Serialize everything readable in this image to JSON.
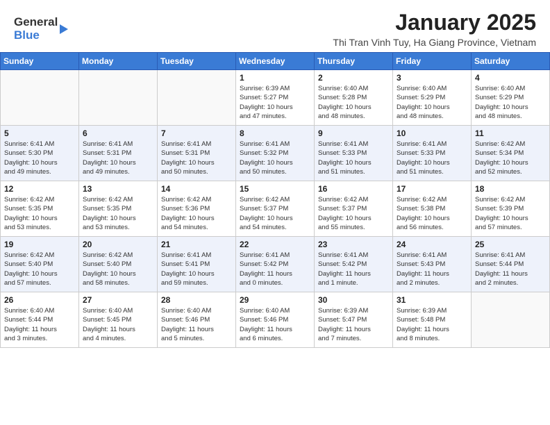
{
  "header": {
    "logo_general": "General",
    "logo_blue": "Blue",
    "month_year": "January 2025",
    "location": "Thi Tran Vinh Tuy, Ha Giang Province, Vietnam"
  },
  "days_of_week": [
    "Sunday",
    "Monday",
    "Tuesday",
    "Wednesday",
    "Thursday",
    "Friday",
    "Saturday"
  ],
  "weeks": [
    [
      {
        "day": "",
        "info": ""
      },
      {
        "day": "",
        "info": ""
      },
      {
        "day": "",
        "info": ""
      },
      {
        "day": "1",
        "info": "Sunrise: 6:39 AM\nSunset: 5:27 PM\nDaylight: 10 hours\nand 47 minutes."
      },
      {
        "day": "2",
        "info": "Sunrise: 6:40 AM\nSunset: 5:28 PM\nDaylight: 10 hours\nand 48 minutes."
      },
      {
        "day": "3",
        "info": "Sunrise: 6:40 AM\nSunset: 5:29 PM\nDaylight: 10 hours\nand 48 minutes."
      },
      {
        "day": "4",
        "info": "Sunrise: 6:40 AM\nSunset: 5:29 PM\nDaylight: 10 hours\nand 48 minutes."
      }
    ],
    [
      {
        "day": "5",
        "info": "Sunrise: 6:41 AM\nSunset: 5:30 PM\nDaylight: 10 hours\nand 49 minutes."
      },
      {
        "day": "6",
        "info": "Sunrise: 6:41 AM\nSunset: 5:31 PM\nDaylight: 10 hours\nand 49 minutes."
      },
      {
        "day": "7",
        "info": "Sunrise: 6:41 AM\nSunset: 5:31 PM\nDaylight: 10 hours\nand 50 minutes."
      },
      {
        "day": "8",
        "info": "Sunrise: 6:41 AM\nSunset: 5:32 PM\nDaylight: 10 hours\nand 50 minutes."
      },
      {
        "day": "9",
        "info": "Sunrise: 6:41 AM\nSunset: 5:33 PM\nDaylight: 10 hours\nand 51 minutes."
      },
      {
        "day": "10",
        "info": "Sunrise: 6:41 AM\nSunset: 5:33 PM\nDaylight: 10 hours\nand 51 minutes."
      },
      {
        "day": "11",
        "info": "Sunrise: 6:42 AM\nSunset: 5:34 PM\nDaylight: 10 hours\nand 52 minutes."
      }
    ],
    [
      {
        "day": "12",
        "info": "Sunrise: 6:42 AM\nSunset: 5:35 PM\nDaylight: 10 hours\nand 53 minutes."
      },
      {
        "day": "13",
        "info": "Sunrise: 6:42 AM\nSunset: 5:35 PM\nDaylight: 10 hours\nand 53 minutes."
      },
      {
        "day": "14",
        "info": "Sunrise: 6:42 AM\nSunset: 5:36 PM\nDaylight: 10 hours\nand 54 minutes."
      },
      {
        "day": "15",
        "info": "Sunrise: 6:42 AM\nSunset: 5:37 PM\nDaylight: 10 hours\nand 54 minutes."
      },
      {
        "day": "16",
        "info": "Sunrise: 6:42 AM\nSunset: 5:37 PM\nDaylight: 10 hours\nand 55 minutes."
      },
      {
        "day": "17",
        "info": "Sunrise: 6:42 AM\nSunset: 5:38 PM\nDaylight: 10 hours\nand 56 minutes."
      },
      {
        "day": "18",
        "info": "Sunrise: 6:42 AM\nSunset: 5:39 PM\nDaylight: 10 hours\nand 57 minutes."
      }
    ],
    [
      {
        "day": "19",
        "info": "Sunrise: 6:42 AM\nSunset: 5:40 PM\nDaylight: 10 hours\nand 57 minutes."
      },
      {
        "day": "20",
        "info": "Sunrise: 6:42 AM\nSunset: 5:40 PM\nDaylight: 10 hours\nand 58 minutes."
      },
      {
        "day": "21",
        "info": "Sunrise: 6:41 AM\nSunset: 5:41 PM\nDaylight: 10 hours\nand 59 minutes."
      },
      {
        "day": "22",
        "info": "Sunrise: 6:41 AM\nSunset: 5:42 PM\nDaylight: 11 hours\nand 0 minutes."
      },
      {
        "day": "23",
        "info": "Sunrise: 6:41 AM\nSunset: 5:42 PM\nDaylight: 11 hours\nand 1 minute."
      },
      {
        "day": "24",
        "info": "Sunrise: 6:41 AM\nSunset: 5:43 PM\nDaylight: 11 hours\nand 2 minutes."
      },
      {
        "day": "25",
        "info": "Sunrise: 6:41 AM\nSunset: 5:44 PM\nDaylight: 11 hours\nand 2 minutes."
      }
    ],
    [
      {
        "day": "26",
        "info": "Sunrise: 6:40 AM\nSunset: 5:44 PM\nDaylight: 11 hours\nand 3 minutes."
      },
      {
        "day": "27",
        "info": "Sunrise: 6:40 AM\nSunset: 5:45 PM\nDaylight: 11 hours\nand 4 minutes."
      },
      {
        "day": "28",
        "info": "Sunrise: 6:40 AM\nSunset: 5:46 PM\nDaylight: 11 hours\nand 5 minutes."
      },
      {
        "day": "29",
        "info": "Sunrise: 6:40 AM\nSunset: 5:46 PM\nDaylight: 11 hours\nand 6 minutes."
      },
      {
        "day": "30",
        "info": "Sunrise: 6:39 AM\nSunset: 5:47 PM\nDaylight: 11 hours\nand 7 minutes."
      },
      {
        "day": "31",
        "info": "Sunrise: 6:39 AM\nSunset: 5:48 PM\nDaylight: 11 hours\nand 8 minutes."
      },
      {
        "day": "",
        "info": ""
      }
    ]
  ]
}
